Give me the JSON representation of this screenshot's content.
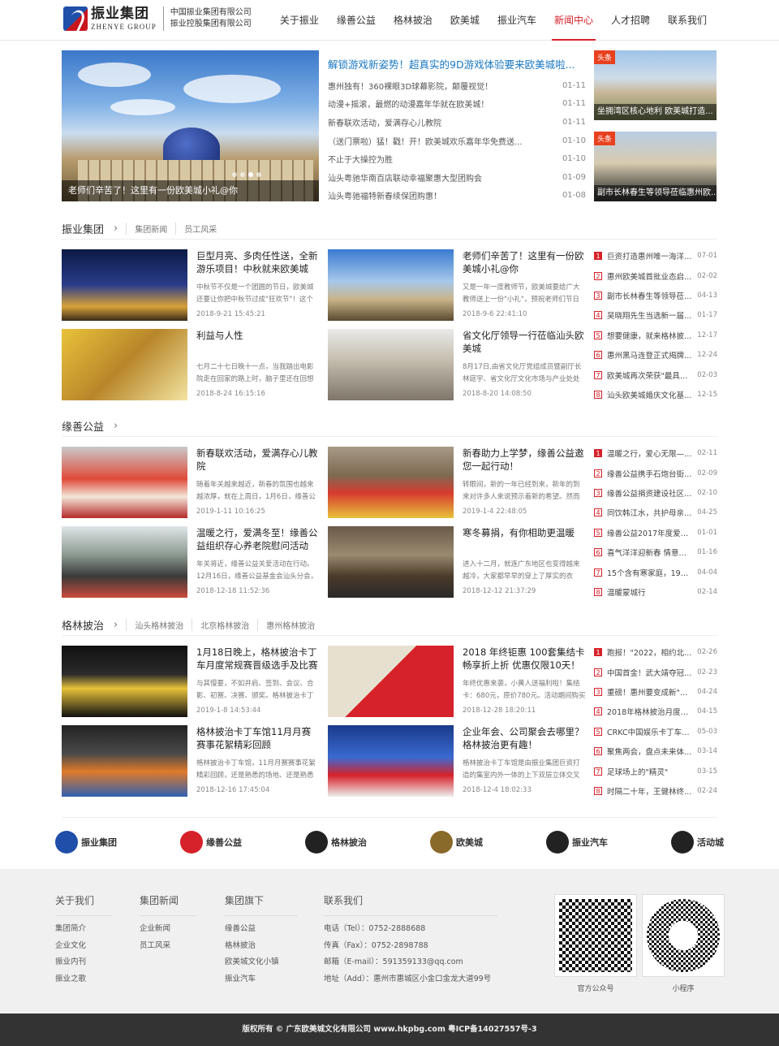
{
  "brand": {
    "name_cn": "振业集团",
    "name_en": "ZHENYE GROUP",
    "sub1": "中国振业集团有限公司",
    "sub2": "振业控股集团有限公司"
  },
  "nav": [
    "关于振业",
    "缘善公益",
    "格林披治",
    "欧美城",
    "振业汽车",
    "新闻中心",
    "人才招聘",
    "联系我们"
  ],
  "nav_active": 5,
  "hero": {
    "caption": "老师们辛苦了！这里有一份欧美城小礼@你"
  },
  "headlines": {
    "title": "解锁游戏新姿势！超真实的9D游戏体验要来欧美城啦...",
    "items": [
      {
        "t": "惠州独有！360裸眼3D球幕影院，颠覆视觉！",
        "d": "01-11"
      },
      {
        "t": "动漫+摇滚，最燃的动漫嘉年华就在欧美城！",
        "d": "01-11"
      },
      {
        "t": "新春联欢活动，爱满存心儿教院",
        "d": "01-11"
      },
      {
        "t": "（送门票啦）猛！戳！开！欧美城欢乐嘉年华免费送...",
        "d": "01-10"
      },
      {
        "t": "不止于大操控为胜",
        "d": "01-10"
      },
      {
        "t": "汕头粤驰华南百店联动幸福聚惠大型团购会",
        "d": "01-09"
      },
      {
        "t": "汕头粤驰福特新春续保团购惠！",
        "d": "01-08"
      }
    ]
  },
  "side": [
    {
      "tag": "头条",
      "cap": "坐拥湾区核心地利 欧美城打造..."
    },
    {
      "tag": "头条",
      "cap": "副市长林春生等领导莅临惠州欧..."
    }
  ],
  "sections": [
    {
      "title": "振业集团",
      "subs": [
        "集团新闻",
        "员工风采"
      ],
      "cards": [
        {
          "tt": "巨型月亮、多肉任性送，全新游乐项目！中秋就来欧美城",
          "ds": "中秋节不仅是一个团圆的节日，欧美城还要让你把中秋节过成\"狂欢节\"！这个中",
          "dt": "2018-9-21 15:45:21"
        },
        {
          "tt": "老师们辛苦了！这里有一份欧美城小礼@你",
          "ds": "又是一年一度教师节，欧美城要给广大教师送上一份\"小礼\"，预祝老师们节日快",
          "dt": "2018-9-6 22:41:10"
        },
        {
          "tt": "利益与人性",
          "ds": "七月二十七日晚十一点，当我踏出电影院走在回家的路上时，脑子里还在回想着这",
          "dt": "2018-8-24 16:15:16"
        },
        {
          "tt": "省文化厅领导一行莅临汕头欧美城",
          "ds": "8月17日,由省文化厅党组成员暨副厅长林庭宇、省文化厅文化市场与产业处处长李",
          "dt": "2018-8-20 14:08:50"
        }
      ],
      "list": [
        {
          "t": "巨资打造惠州唯一海洋世...",
          "d": "07-01"
        },
        {
          "t": "惠州欧美城首批业态启动...",
          "d": "02-02"
        },
        {
          "t": "副市长林春生等领导莅临...",
          "d": "04-13"
        },
        {
          "t": "吴晓翔先生当选新一届香...",
          "d": "01-17"
        },
        {
          "t": "想要健康，就来格林披治...",
          "d": "12-17"
        },
        {
          "t": "惠州黑马连登正式揭牌开...",
          "d": "12-24"
        },
        {
          "t": "欧美城再次荣获\"最具发...",
          "d": "02-03"
        },
        {
          "t": "汕头欧美城婚庆文化基地...",
          "d": "12-15"
        }
      ]
    },
    {
      "title": "缘善公益",
      "subs": [],
      "cards": [
        {
          "tt": "新春联欢活动，爱满存心儿教院",
          "ds": "随着年关越来越近，新春的氛围也越来越浓厚，就在上周日，1月6日，缘善公益联",
          "dt": "2019-1-11 10:16:25"
        },
        {
          "tt": "新春助力上学梦，缘善公益邀您一起行动！",
          "ds": "转眼间，新的一年已经到来，新年的到来对许多人来说预示着新的希望。然而有的",
          "dt": "2019-1-4 22:48:05"
        },
        {
          "tt": "温暖之行，爱满冬至！缘善公益组织存心养老院慰问活动",
          "ds": "年关将近，缘善公益关爱活动在行动。12月16日，缘善公益基金会汕头分会，带领",
          "dt": "2018-12-18 11:52:36"
        },
        {
          "tt": "寒冬募捐，有你相助更温暖",
          "ds": "进入十二月，就连广东地区也变得越来越冷，大家都早早的穿上了厚实的衣物，围上",
          "dt": "2018-12-12 21:37:29"
        }
      ],
      "list": [
        {
          "t": "温暖之行，爱心无限——...",
          "d": "02-11"
        },
        {
          "t": "缘善公益携手石炮台街道...",
          "d": "02-09"
        },
        {
          "t": "缘善公益捐资建设社区文...",
          "d": "02-10"
        },
        {
          "t": "同饮韩江水，共护母亲河...",
          "d": "04-25"
        },
        {
          "t": "缘善公益2017年度爱心历...",
          "d": "01-01"
        },
        {
          "t": "喜气洋洋迎新春 情意浓浓...",
          "d": "01-16"
        },
        {
          "t": "15个含有寒家庭，19个寒门...",
          "d": "04-04"
        },
        {
          "t": "温暖蒙城行",
          "d": "02-14"
        }
      ]
    },
    {
      "title": "格林披治",
      "subs": [
        "汕头格林披治",
        "北京格林披治",
        "惠州格林披治"
      ],
      "cards": [
        {
          "tt": "1月18日晚上，格林披治卡丁车月度常规赛晋级选手及比赛",
          "ds": "与其慢要，不如并肩、签到、会议、合影、初赛、决赛、颁奖。格林披治卡丁车",
          "dt": "2019-1-8 14:53:44"
        },
        {
          "tt": "2018 年终钜惠 100套集结卡畅享折上折 优惠仅限10天！",
          "ds": "年终优惠来袭，小黄人送福利啦！集结卡：680元，原价780元。活动期间购买",
          "dt": "2018-12-28 18:20:11"
        },
        {
          "tt": "格林披治卡丁车馆11月月赛赛事花絮精彩回顾",
          "ds": "格林披治卡丁车馆，11月月赛赛事花絮精彩回顾，还是熟悉的场地、还是熟悉的会",
          "dt": "2018-12-16 17:45:04"
        },
        {
          "tt": "企业年会、公司聚会去哪里？格林披治更有趣！",
          "ds": "格林披治卡丁车馆是由振业集团巨资打造的集室内外一体的上下双层立体交叉式赛",
          "dt": "2018-12-4 18:02:33"
        }
      ],
      "list": [
        {
          "t": "跑报！\"2022，相约北京...",
          "d": "02-26"
        },
        {
          "t": "中国首金！武大靖夺冠，...",
          "d": "02-23"
        },
        {
          "t": "重磅！惠州要变成新\"深...",
          "d": "04-24"
        },
        {
          "t": "2018年格林披治月度常规...",
          "d": "04-15"
        },
        {
          "t": "CRKC中国娱乐卡丁车大...",
          "d": "05-03"
        },
        {
          "t": "聚焦两会，盘点未来体育...",
          "d": "03-14"
        },
        {
          "t": "足球场上的\"精灵\"",
          "d": "03-15"
        },
        {
          "t": "时隔二十年，王健林终究...",
          "d": "02-24"
        }
      ]
    }
  ],
  "partners": [
    {
      "name": "振业集团",
      "color": "#1f4fa8"
    },
    {
      "name": "缘善公益",
      "color": "#d6222a"
    },
    {
      "name": "格林披治",
      "color": "#222222"
    },
    {
      "name": "欧美城",
      "color": "#8a6a2a"
    },
    {
      "name": "振业汽车",
      "color": "#222222"
    },
    {
      "name": "活动城",
      "color": "#222222"
    }
  ],
  "footer": {
    "cols": [
      {
        "h": "关于我们",
        "items": [
          "集团简介",
          "企业文化",
          "振业内刊",
          "振业之歌"
        ]
      },
      {
        "h": "集团新闻",
        "items": [
          "企业新闻",
          "员工风采"
        ]
      },
      {
        "h": "集团旗下",
        "items": [
          "缘善公益",
          "格林披治",
          "欧美城文化小镇",
          "振业汽车"
        ]
      },
      {
        "h": "联系我们",
        "items": [
          "电话（Tel）：0752-2888688",
          "传真（Fax）：0752-2898788",
          "邮箱（E-mail）：591359133@qq.com",
          "地址（Add）：惠州市惠城区小金口金龙大道99号"
        ]
      }
    ],
    "qr": [
      "官方公众号",
      "小程序"
    ]
  },
  "copyright": "版权所有 © 广东欧美城文化有限公司    www.hkpbg.com    粤ICP备14027557号-3"
}
